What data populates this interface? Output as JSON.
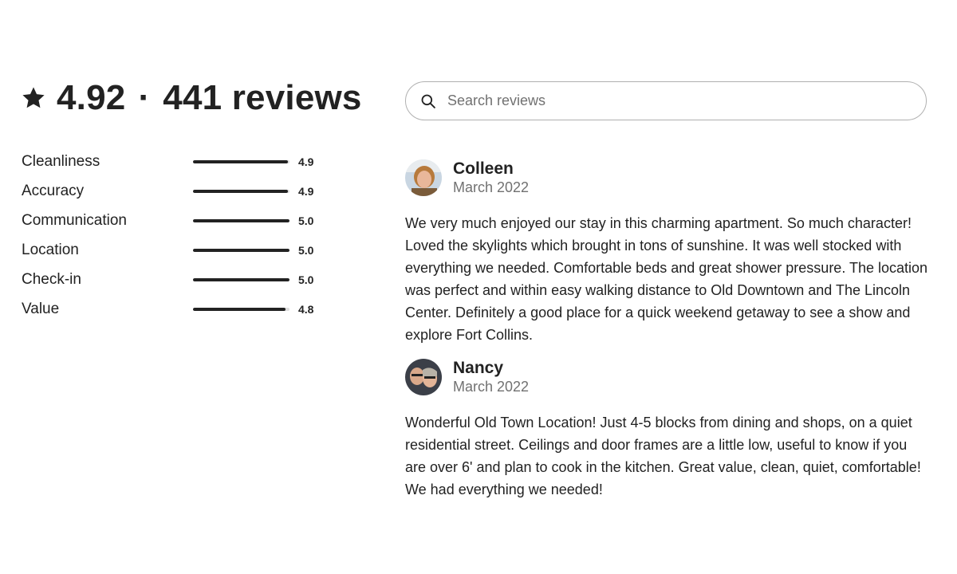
{
  "summary": {
    "rating": "4.92",
    "separator": "·",
    "reviews_count": "441 reviews",
    "star_icon": "star-icon"
  },
  "ratings": [
    {
      "label": "Cleanliness",
      "value": "4.9",
      "fraction": 0.98
    },
    {
      "label": "Accuracy",
      "value": "4.9",
      "fraction": 0.98
    },
    {
      "label": "Communication",
      "value": "5.0",
      "fraction": 1.0
    },
    {
      "label": "Location",
      "value": "5.0",
      "fraction": 1.0
    },
    {
      "label": "Check-in",
      "value": "5.0",
      "fraction": 1.0
    },
    {
      "label": "Value",
      "value": "4.8",
      "fraction": 0.96
    }
  ],
  "search": {
    "placeholder": "Search reviews",
    "icon": "search-icon"
  },
  "reviews": [
    {
      "name": "Colleen",
      "date": "March 2022",
      "text": "We very much enjoyed our stay in this charming apartment. So much character! Loved the skylights which brought in tons of sunshine. It was well stocked with everything we needed. Comfortable beds and great shower pressure. The location was perfect and within easy walking distance to Old Downtown and The Lincoln Center. Definitely a good place for a quick weekend getaway to see a show and explore Fort Collins."
    },
    {
      "name": "Nancy",
      "date": "March 2022",
      "text": "Wonderful Old Town Location! Just 4-5 blocks from dining and shops, on a quiet residential street. Ceilings and door frames are a little low, useful to know if you are over 6' and plan to cook in the kitchen. Great value, clean, quiet, comfortable! We had everything we needed!"
    }
  ],
  "colors": {
    "text": "#222222",
    "muted": "#717171",
    "bar_track": "#dddddd",
    "bar_fill": "#222222",
    "border": "#b0b0b0"
  }
}
